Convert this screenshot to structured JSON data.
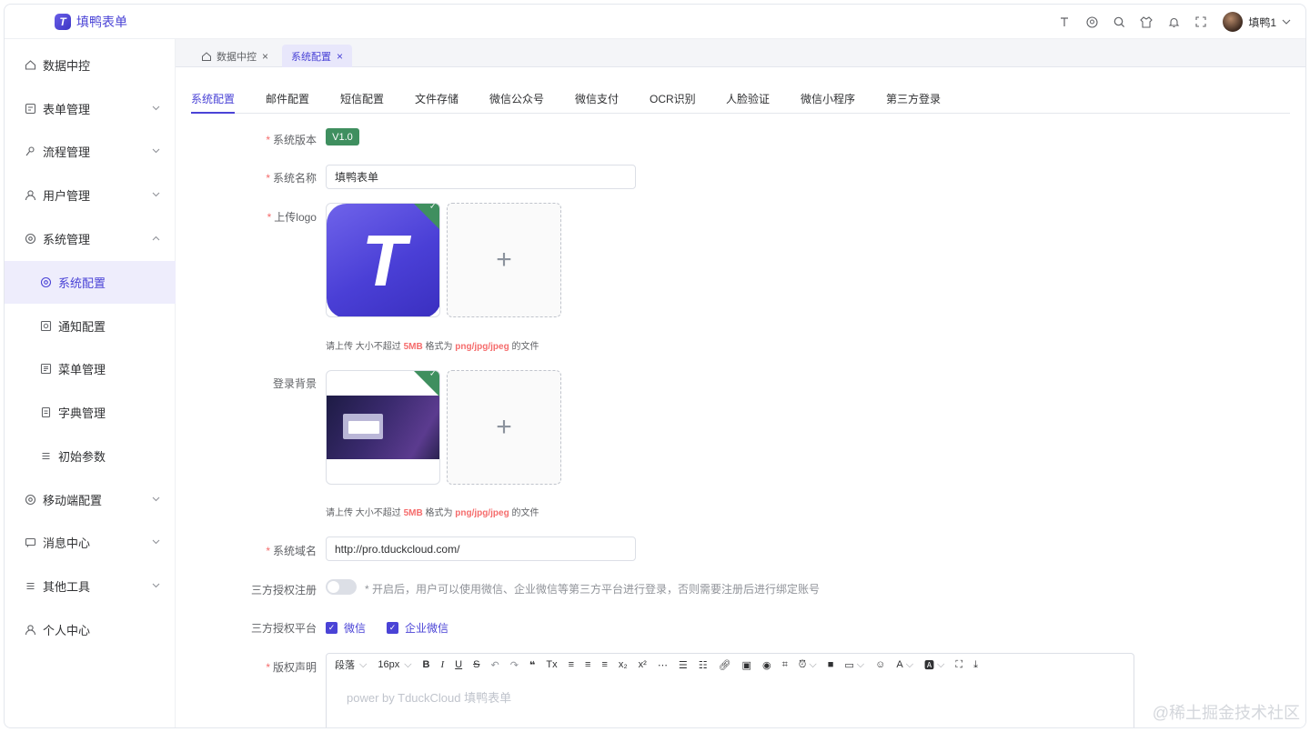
{
  "app": {
    "name": "填鸭表单",
    "logo_letter": "T"
  },
  "header": {
    "user_name": "填鸭1",
    "icons": [
      "text-size-icon",
      "github-icon",
      "search-icon",
      "skin-icon",
      "bell-icon",
      "fullscreen-icon"
    ]
  },
  "sidebar": {
    "items": [
      {
        "label": "数据中控",
        "icon": "home-icon"
      },
      {
        "label": "表单管理",
        "icon": "form-icon"
      },
      {
        "label": "流程管理",
        "icon": "flow-icon"
      },
      {
        "label": "用户管理",
        "icon": "user-icon"
      },
      {
        "label": "系统管理",
        "icon": "gear-icon"
      },
      {
        "label": "系统配置",
        "icon": "gear-icon"
      },
      {
        "label": "通知配置",
        "icon": "notice-icon"
      },
      {
        "label": "菜单管理",
        "icon": "menu-icon"
      },
      {
        "label": "字典管理",
        "icon": "dict-icon"
      },
      {
        "label": "初始参数",
        "icon": "list-icon"
      },
      {
        "label": "移动端配置",
        "icon": "gear-icon"
      },
      {
        "label": "消息中心",
        "icon": "message-icon"
      },
      {
        "label": "其他工具",
        "icon": "tools-icon"
      },
      {
        "label": "个人中心",
        "icon": "person-icon"
      }
    ]
  },
  "page_tabs": [
    {
      "label": "数据中控",
      "close": "×"
    },
    {
      "label": "系统配置",
      "close": "×"
    }
  ],
  "sub_tabs": [
    "系统配置",
    "邮件配置",
    "短信配置",
    "文件存储",
    "微信公众号",
    "微信支付",
    "OCR识别",
    "人脸验证",
    "微信小程序",
    "第三方登录"
  ],
  "form": {
    "version_label": "系统版本",
    "version_value": "V1.0",
    "name_label": "系统名称",
    "name_value": "填鸭表单",
    "logo_label": "上传logo",
    "upload_hint": {
      "prefix": "请上传 大小不超过 ",
      "size": "5MB",
      "mid": " 格式为 ",
      "formats": "png/jpg/jpeg",
      "suffix": " 的文件"
    },
    "bg_label": "登录背景",
    "domain_label": "系统域名",
    "domain_value": "http://pro.tduckcloud.com/",
    "third_reg_label": "三方授权注册",
    "third_reg_tip": "* 开启后，用户可以使用微信、企业微信等第三方平台进行登录，否则需要注册后进行绑定账号",
    "third_platform_label": "三方授权平台",
    "platforms": [
      "微信",
      "企业微信"
    ],
    "copyright_label": "版权声明",
    "editor": {
      "paragraph": "段落",
      "font_size": "16px",
      "placeholder": "power by TduckCloud 填鸭表单"
    }
  },
  "watermark": "@稀土掘金技术社区"
}
